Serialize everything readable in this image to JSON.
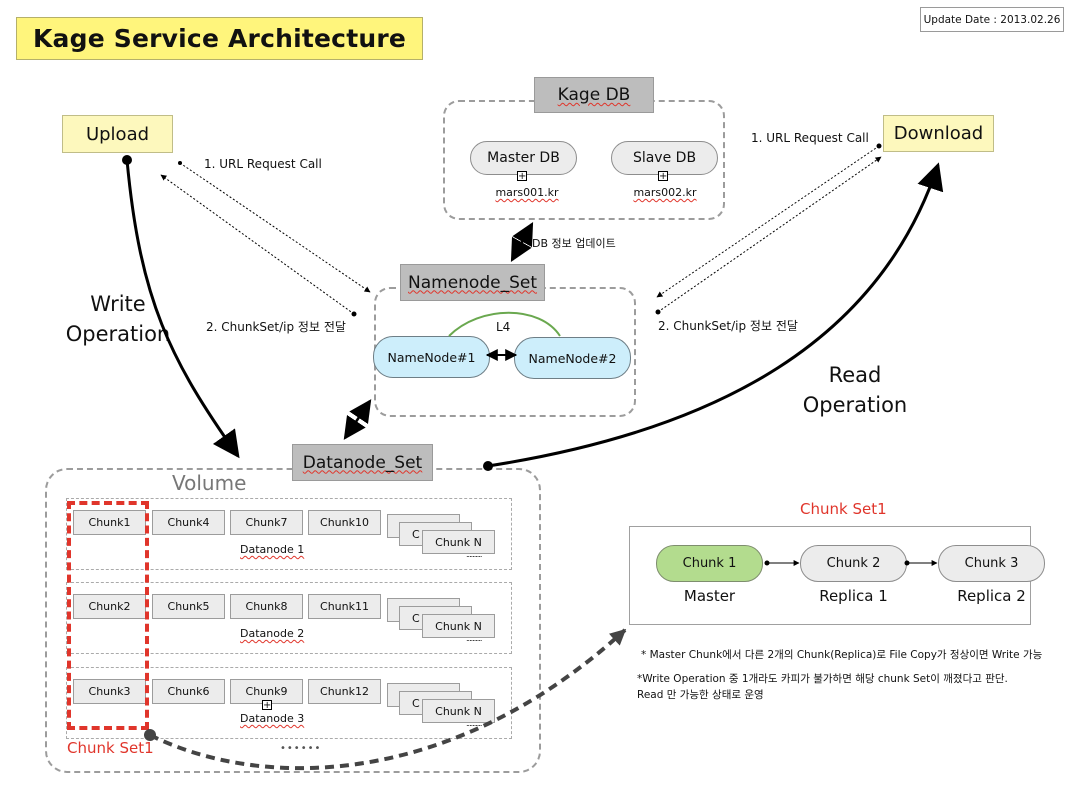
{
  "title": "Kage Service Architecture",
  "update_date": "Update Date : 2013.02.26",
  "upload": {
    "label": "Upload"
  },
  "download": {
    "label": "Download"
  },
  "kage_db": {
    "label": "Kage DB",
    "master": {
      "label": "Master DB",
      "host": "mars001.kr"
    },
    "slave": {
      "label": "Slave DB",
      "host": "mars002.kr"
    },
    "update_label": "DB 정보 업데이트"
  },
  "namenode_set": {
    "label": "Namenode_Set",
    "lb_label": "L4",
    "nodes": [
      "NameNode#1",
      "NameNode#2"
    ]
  },
  "flows": {
    "upload_request": "1. URL Request Call",
    "upload_response": "2.  ChunkSet/ip 정보 전달",
    "download_request": "1. URL Request Call",
    "download_response": "2.  ChunkSet/ip 정보 전달"
  },
  "operations": {
    "write": [
      "Write",
      "Operation"
    ],
    "read": [
      "Read",
      "Operation"
    ]
  },
  "datanode_set": {
    "label": "Datanode_Set",
    "volume_label": "Volume",
    "datanodes": [
      {
        "label": "Datanode 1",
        "chunks": [
          "Chunk1",
          "Chunk4",
          "Chunk7",
          "Chunk10"
        ],
        "stack_label": "Chunk N",
        "stack_hidden": "C"
      },
      {
        "label": "Datanode 2",
        "chunks": [
          "Chunk2",
          "Chunk5",
          "Chunk8",
          "Chunk11"
        ],
        "stack_label": "Chunk N",
        "stack_hidden": "C"
      },
      {
        "label": "Datanode 3",
        "chunks": [
          "Chunk3",
          "Chunk6",
          "Chunk9",
          "Chunk12"
        ],
        "stack_label": "Chunk N",
        "stack_hidden": "C"
      }
    ],
    "more_rows": "••••••",
    "more_chunks": "..........",
    "chunk_set_highlight": "Chunk Set1"
  },
  "chunk_set_detail": {
    "title": "Chunk Set1",
    "chunks": [
      {
        "label": "Chunk 1",
        "role": "Master"
      },
      {
        "label": "Chunk 2",
        "role": "Replica 1"
      },
      {
        "label": "Chunk 3",
        "role": "Replica 2"
      }
    ],
    "notes": [
      "* Master Chunk에서 다른 2개의 Chunk(Replica)로 File Copy가 정상이면 Write 가능",
      "*Write Operation 중 1개라도 카피가 불가하면 해당 chunk Set이 깨졌다고 판단.",
      "Read 만 가능한 상태로 운영"
    ]
  },
  "colors": {
    "title_bg": "#fff57c",
    "endpoint_bg": "#fdf8bd",
    "namenode_bg": "#cdeefb",
    "master_chunk_bg": "#b3dc8e",
    "header_gray": "#bdbdbd",
    "chunk_set_red": "#e0352b",
    "l4_green": "#6aa84f"
  }
}
